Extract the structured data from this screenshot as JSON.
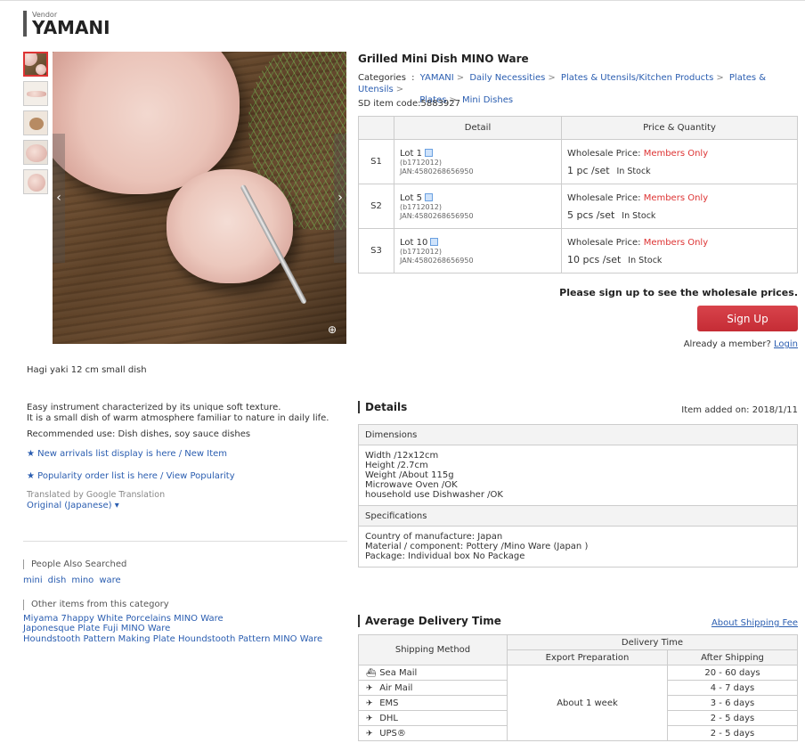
{
  "vendor": {
    "label": "Vendor",
    "name": "YAMANI"
  },
  "product": {
    "title": "Grilled Mini Dish MINO Ware",
    "categories_label": "Categories",
    "categories": [
      "YAMANI",
      "Daily Necessities",
      "Plates & Utensils/Kitchen Products",
      "Plates & Utensils",
      "Plates",
      "Mini Dishes"
    ],
    "sd_code": "SD item code:5883927"
  },
  "lot_table": {
    "headers": [
      "Detail",
      "Price & Quantity"
    ],
    "rows": [
      {
        "id": "S1",
        "lot": "Lot 1",
        "code": "(b1712012)",
        "jan": "JAN:4580268656950",
        "price_label": "Wholesale Price:",
        "price_value": "Members Only",
        "qty": "1 pc /set",
        "stock": "In Stock"
      },
      {
        "id": "S2",
        "lot": "Lot 5",
        "code": "(b1712012)",
        "jan": "JAN:4580268656950",
        "price_label": "Wholesale Price:",
        "price_value": "Members Only",
        "qty": "5 pcs /set",
        "stock": "In Stock"
      },
      {
        "id": "S3",
        "lot": "Lot 10",
        "code": "(b1712012)",
        "jan": "JAN:4580268656950",
        "price_label": "Wholesale Price:",
        "price_value": "Members Only",
        "qty": "10 pcs /set",
        "stock": "In Stock"
      }
    ]
  },
  "signup": {
    "prompt": "Please sign up to see the wholesale prices.",
    "button": "Sign Up",
    "member_text": "Already a member?",
    "login": "Login"
  },
  "description": {
    "subtitle": "Hagi yaki 12 cm small dish",
    "line1": "Easy instrument characterized by its unique soft texture.",
    "line2": "It is a small dish of warm atmosphere familiar to nature in daily life.",
    "recommended": "Recommended use: Dish dishes, soy sauce dishes",
    "new_arrivals": "New arrivals list display is here / New Item",
    "popularity": "Popularity order list is here / View Popularity",
    "translated": "Translated by Google Translation",
    "original": "Original (Japanese)"
  },
  "people_also_searched": {
    "label": "People Also Searched",
    "tags": [
      "mini",
      "dish",
      "mino",
      "ware"
    ]
  },
  "other_items": {
    "label": "Other items from this category",
    "items": [
      "Miyama 7happy White Porcelains MINO Ware",
      "Japonesque Plate Fuji MINO Ware",
      "Houndstooth Pattern Making Plate Houndstooth Pattern MINO Ware"
    ]
  },
  "details": {
    "title": "Details",
    "added": "Item added on: 2018/1/11",
    "dimensions_label": "Dimensions",
    "dimensions": [
      "Width /12x12cm",
      "Height /2.7cm",
      "Weight /About 115g",
      "Microwave Oven /OK",
      "household use Dishwasher /OK"
    ],
    "specs_label": "Specifications",
    "specs": [
      "Country of manufacture: Japan",
      "Material / component: Pottery /Mino Ware (Japan )",
      "Package: Individual box No Package"
    ]
  },
  "delivery": {
    "title": "Average Delivery Time",
    "fee_link": "About Shipping Fee",
    "method_header": "Shipping Method",
    "time_header": "Delivery Time",
    "export_header": "Export Preparation",
    "after_header": "After Shipping",
    "export_value": "About 1 week",
    "rows": [
      {
        "icon": "ship-icon",
        "method": "Sea Mail",
        "after": "20 - 60 days"
      },
      {
        "icon": "plane-icon",
        "method": "Air Mail",
        "after": "4 - 7 days"
      },
      {
        "icon": "plane-icon",
        "method": "EMS",
        "after": "3 - 6 days"
      },
      {
        "icon": "plane-icon",
        "method": "DHL",
        "after": "2 - 5 days"
      },
      {
        "icon": "plane-icon",
        "method": "UPS®",
        "after": "2 - 5 days"
      }
    ]
  },
  "colors": {
    "accent_red": "#d33333",
    "link_blue": "#2a5db0",
    "button_red": "#c52c35"
  }
}
